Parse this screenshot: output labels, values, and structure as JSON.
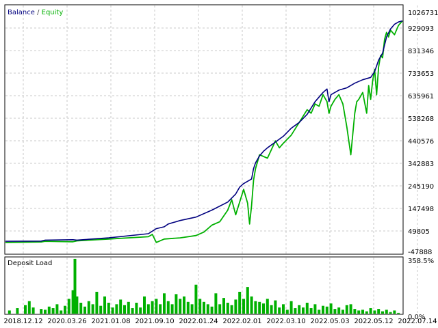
{
  "legend": {
    "balance_label": "Balance",
    "separator": " / ",
    "equity_label": "Equity"
  },
  "colors": {
    "balance": "#00007f",
    "equity": "#00b000",
    "deposit_load": "#00b000",
    "grid": "#c8c8c8",
    "frame": "#000000"
  },
  "chart_data": [
    {
      "type": "line",
      "title": "",
      "xlabel": "",
      "ylabel": "",
      "grid": true,
      "legend_position": "top-left",
      "ylim": [
        -47888,
        1026731
      ],
      "y_ticks": [
        "1026731",
        "929093",
        "831346",
        "733653",
        "635961",
        "538268",
        "440576",
        "342883",
        "245190",
        "147498",
        "49805",
        "-47888"
      ],
      "x_ticks": [
        "2018.12.12",
        "2020.03.26",
        "2021.01.08",
        "2021.09.10",
        "2022.01.24",
        "2022.02.01",
        "2022.03.10",
        "2022.05.03",
        "2022.05.12",
        "2022.07.14"
      ],
      "x_range": [
        0,
        100
      ],
      "series": [
        {
          "name": "Balance",
          "x": [
            0,
            9,
            10,
            17,
            18,
            26,
            36,
            38,
            40,
            41,
            44,
            48,
            52,
            56,
            58,
            59,
            60,
            62,
            62.5,
            63,
            64,
            65,
            66,
            68,
            70,
            72,
            74,
            76,
            78,
            80,
            81,
            81.5,
            82,
            84,
            86,
            88,
            90,
            92,
            93,
            94,
            95,
            96,
            97,
            98,
            99,
            100
          ],
          "y": [
            5000,
            6000,
            10000,
            12000,
            10000,
            20000,
            38000,
            60000,
            68000,
            80000,
            95000,
            110000,
            140000,
            175000,
            210000,
            240000,
            255000,
            275000,
            320000,
            345000,
            375000,
            395000,
            410000,
            435000,
            460000,
            495000,
            520000,
            555000,
            610000,
            650000,
            665000,
            610000,
            640000,
            660000,
            670000,
            690000,
            705000,
            715000,
            740000,
            790000,
            820000,
            890000,
            925000,
            945000,
            955000,
            960000
          ]
        },
        {
          "name": "Equity",
          "x": [
            0,
            9,
            10,
            17,
            18,
            26,
            36,
            37,
            38,
            40,
            44,
            48,
            50,
            52,
            54,
            56,
            57,
            58,
            59,
            60,
            61,
            61.5,
            62,
            62.5,
            63,
            64,
            66,
            68,
            69,
            70,
            72,
            74,
            76,
            77,
            78,
            79,
            80,
            81,
            81.5,
            82,
            83,
            84,
            85,
            86,
            86.5,
            87,
            87.5,
            88,
            88.5,
            89,
            90,
            91,
            91.5,
            92,
            92.5,
            93,
            93.5,
            94,
            94.5,
            95,
            95.5,
            96,
            96.5,
            97,
            98,
            99,
            100
          ],
          "y": [
            0,
            2000,
            5000,
            3000,
            7000,
            15000,
            25000,
            35000,
            0,
            15000,
            20000,
            30000,
            45000,
            75000,
            90000,
            140000,
            185000,
            120000,
            175000,
            230000,
            170000,
            80000,
            160000,
            270000,
            320000,
            380000,
            365000,
            440000,
            410000,
            430000,
            465000,
            520000,
            575000,
            560000,
            600000,
            590000,
            640000,
            610000,
            560000,
            590000,
            620000,
            640000,
            600000,
            500000,
            440000,
            380000,
            470000,
            560000,
            610000,
            620000,
            650000,
            560000,
            680000,
            620000,
            700000,
            750000,
            640000,
            760000,
            810000,
            800000,
            880000,
            910000,
            890000,
            920000,
            900000,
            940000,
            960000
          ]
        }
      ]
    },
    {
      "type": "bar",
      "title": "Deposit Load",
      "grid": true,
      "ylim": [
        0,
        358.5
      ],
      "y_ticks": [
        "358.5%",
        "0.0%"
      ],
      "series": [
        {
          "name": "Deposit Load",
          "x": [
            1,
            3,
            5,
            6,
            7,
            9,
            10,
            11,
            12,
            13,
            14,
            15,
            16,
            17,
            17.5,
            18,
            19,
            20,
            21,
            22,
            23,
            24,
            25,
            26,
            27,
            28,
            29,
            30,
            31,
            32,
            33,
            34,
            35,
            36,
            37,
            38,
            39,
            40,
            41,
            42,
            43,
            44,
            45,
            46,
            47,
            48,
            49,
            50,
            51,
            52,
            53,
            54,
            55,
            56,
            57,
            58,
            59,
            60,
            61,
            62,
            63,
            64,
            65,
            66,
            67,
            68,
            69,
            70,
            71,
            72,
            73,
            74,
            75,
            76,
            77,
            78,
            79,
            80,
            81,
            82,
            83,
            84,
            85,
            86,
            87,
            88,
            89,
            90,
            91,
            92,
            93,
            94,
            95,
            96,
            97,
            98,
            99
          ],
          "y": [
            20,
            35,
            55,
            80,
            40,
            30,
            25,
            45,
            35,
            60,
            20,
            50,
            95,
            150,
            350,
            110,
            70,
            45,
            80,
            60,
            140,
            50,
            110,
            70,
            40,
            60,
            90,
            55,
            75,
            35,
            70,
            40,
            110,
            60,
            80,
            95,
            60,
            130,
            80,
            60,
            125,
            95,
            110,
            75,
            60,
            185,
            95,
            75,
            60,
            45,
            130,
            60,
            100,
            70,
            55,
            90,
            140,
            95,
            170,
            110,
            80,
            75,
            65,
            95,
            55,
            85,
            40,
            60,
            25,
            80,
            35,
            55,
            40,
            70,
            35,
            60,
            25,
            50,
            45,
            65,
            30,
            40,
            25,
            55,
            60,
            30,
            20,
            25,
            15,
            35,
            20,
            30,
            15,
            25,
            10,
            20,
            5
          ]
        }
      ]
    }
  ]
}
